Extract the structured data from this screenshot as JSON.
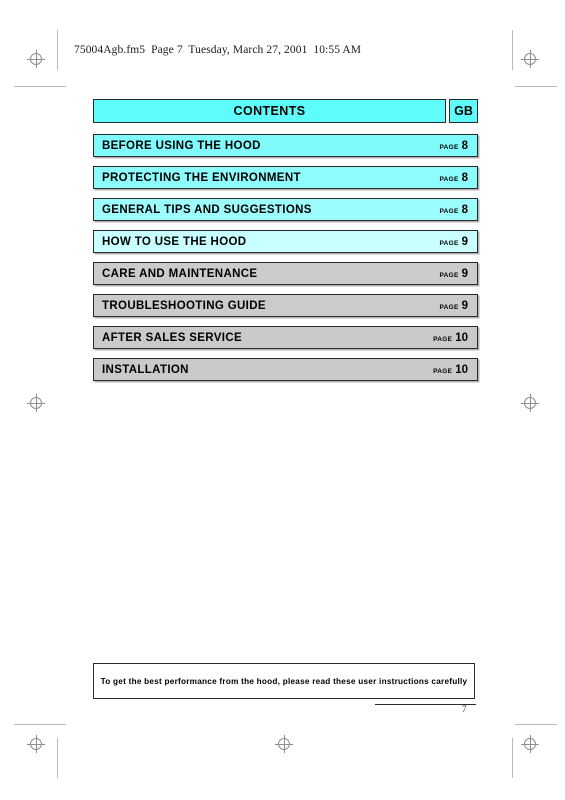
{
  "document": {
    "running_header": "75004Agb.fm5  Page 7  Tuesday, March 27, 2001  10:55 AM",
    "page_number": "7"
  },
  "contents": {
    "title": "CONTENTS",
    "language_code": "GB",
    "page_word": "PAGE",
    "entries": [
      {
        "label": "BEFORE USING THE HOOD",
        "page": "8"
      },
      {
        "label": "PROTECTING THE ENVIRONMENT",
        "page": "8"
      },
      {
        "label": "GENERAL TIPS AND SUGGESTIONS",
        "page": "8"
      },
      {
        "label": "HOW TO USE THE HOOD",
        "page": "9"
      },
      {
        "label": "CARE AND MAINTENANCE",
        "page": "9"
      },
      {
        "label": "TROUBLESHOOTING GUIDE",
        "page": "9"
      },
      {
        "label": "AFTER SALES SERVICE",
        "page": "10"
      },
      {
        "label": "INSTALLATION",
        "page": "10"
      }
    ]
  },
  "footer": {
    "note": "To get the best performance from the hood, please read these user instructions carefully"
  },
  "colors": {
    "header_cyan": "#5FFCFC",
    "row_1": "#7FFBFB",
    "row_2": "#8CFCFC",
    "row_3": "#9DFDFD",
    "row_4": "#C8FFFF",
    "row_5": "#CCCCCC",
    "row_6": "#CBCBCB",
    "row_7": "#CACACA",
    "row_8": "#CACACA",
    "border": "#2A2A2A",
    "paper": "#FFFFFF",
    "mark": "#8D8D92"
  }
}
